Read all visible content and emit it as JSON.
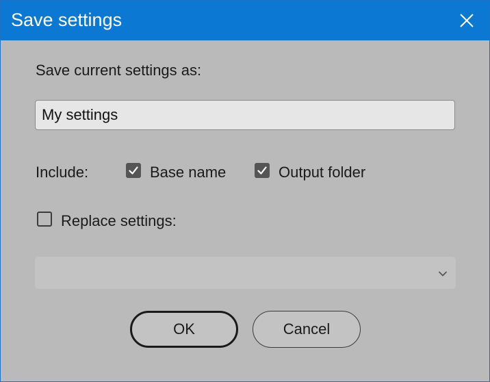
{
  "window": {
    "title": "Save settings",
    "close_icon": "close-icon",
    "colors": {
      "titlebar": "#0b78d4",
      "title_text": "#ffffff",
      "body": "#bababa"
    }
  },
  "form": {
    "prompt": "Save current settings as:",
    "name_value": "My settings",
    "include_label": "Include:",
    "include_options": [
      {
        "label": "Base name",
        "checked": true
      },
      {
        "label": "Output folder",
        "checked": true
      }
    ],
    "replace": {
      "label": "Replace settings:",
      "checked": false
    },
    "replace_select": {
      "value": "",
      "disabled": true,
      "icon": "chevron-down-icon"
    }
  },
  "buttons": {
    "ok": "OK",
    "cancel": "Cancel"
  }
}
